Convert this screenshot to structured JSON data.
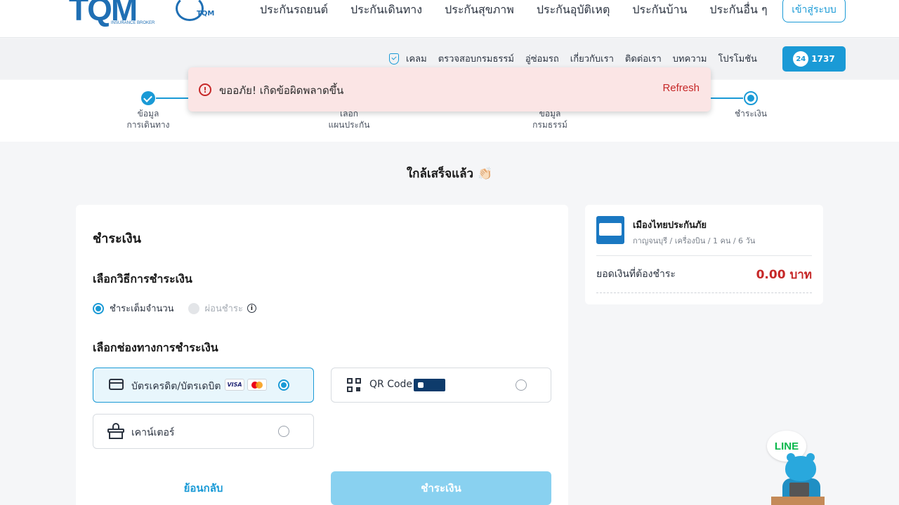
{
  "header": {
    "logo_text": "TQM",
    "logo_sub": "INSURANCE BROKER",
    "anniv_text": "TQM",
    "nav": [
      "ประกันรถยนต์",
      "ประกันเดินทาง",
      "ประกันสุขภาพ",
      "ประกันอุบัติเหตุ",
      "ประกันบ้าน",
      "ประกันอื่น ๆ"
    ],
    "login_label": "เข้าสู่ระบบ"
  },
  "subnav": {
    "items": [
      "เคลม",
      "ตรวจสอบกรมธรรม์",
      "อู่ซ่อมรถ",
      "เกี่ยวกับเรา",
      "ติดต่อเรา",
      "บทความ",
      "โปรโมชัน"
    ],
    "hotline_24": "24",
    "hotline": "1737"
  },
  "stepper": {
    "steps": [
      {
        "label1": "ข้อมูล",
        "label2": "การเดินทาง",
        "state": "done"
      },
      {
        "label1": "เลือก",
        "label2": "แผนประกัน",
        "state": "done"
      },
      {
        "label1": "ข้อมูล",
        "label2": "กรมธรรม์",
        "state": "done"
      },
      {
        "label1": "ชำระเงิน",
        "label2": "",
        "state": "current"
      }
    ]
  },
  "toast": {
    "message": "ขออภัย! เกิดข้อผิดพลาดขึ้น",
    "action": "Refresh"
  },
  "page": {
    "heading": "ใกล้เสร็จแล้ว 👏🏻"
  },
  "payment": {
    "title": "ชำระเงิน",
    "method_title": "เลือกวิธีการชำระเงิน",
    "method_full": "ชำระเต็มจำนวน",
    "method_installment": "ผ่อนชำระ",
    "channel_title": "เลือกช่องทางการชำระเงิน",
    "channel_card": "บัตรเครดิต/บัตรเดบิต",
    "visa_text": "VISA",
    "channel_qr": "QR Code",
    "channel_counter": "เคาน์เตอร์",
    "back_label": "ย้อนกลับ",
    "pay_label": "ชำระเงิน"
  },
  "summary": {
    "insurer": "เมืองไทยประกันภัย",
    "detail": "กาญจนบุรี / เครื่องบิน / 1 คน / 6 วัน",
    "total_label": "ยอดเงินที่ต้องชำระ",
    "total_value": "0.00 บาท"
  },
  "line_widget": {
    "label": "LINE"
  },
  "colors": {
    "accent": "#1a9ad6",
    "error": "#c62828",
    "toast_bg": "#fbe5e5",
    "selected_bg": "#e8f6fc"
  }
}
